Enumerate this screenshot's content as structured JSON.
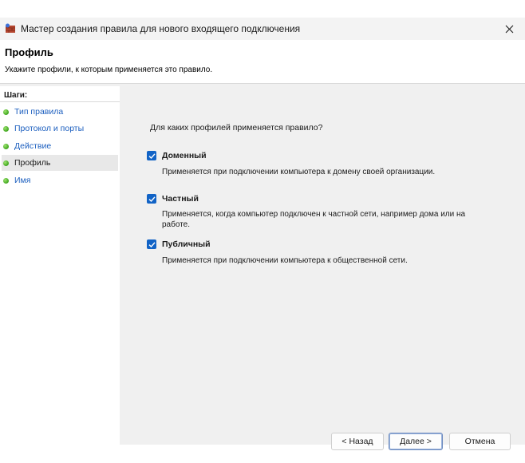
{
  "window": {
    "title": "Мастер создания правила для нового входящего подключения"
  },
  "header": {
    "title": "Профиль",
    "subtitle": "Укажите профили, к которым применяется это правило."
  },
  "steps": {
    "heading": "Шаги:",
    "items": [
      {
        "label": "Тип правила",
        "current": false
      },
      {
        "label": "Протокол и порты",
        "current": false
      },
      {
        "label": "Действие",
        "current": false
      },
      {
        "label": "Профиль",
        "current": true
      },
      {
        "label": "Имя",
        "current": false
      }
    ]
  },
  "content": {
    "question": "Для каких профилей применяется правило?",
    "profiles": [
      {
        "label": "Доменный",
        "checked": true,
        "description": "Применяется при подключении компьютера к домену своей организации."
      },
      {
        "label": "Частный",
        "checked": true,
        "description": "Применяется, когда компьютер подключен к частной сети, например дома или на работе."
      },
      {
        "label": "Публичный",
        "checked": true,
        "description": "Применяется при подключении компьютера к общественной сети."
      }
    ]
  },
  "buttons": {
    "back": "< Назад",
    "next": "Далее >",
    "cancel": "Отмена"
  },
  "colors": {
    "checkbox": "#1163c6",
    "link": "#1c5fbf",
    "step_dot": "#3fa61e"
  }
}
